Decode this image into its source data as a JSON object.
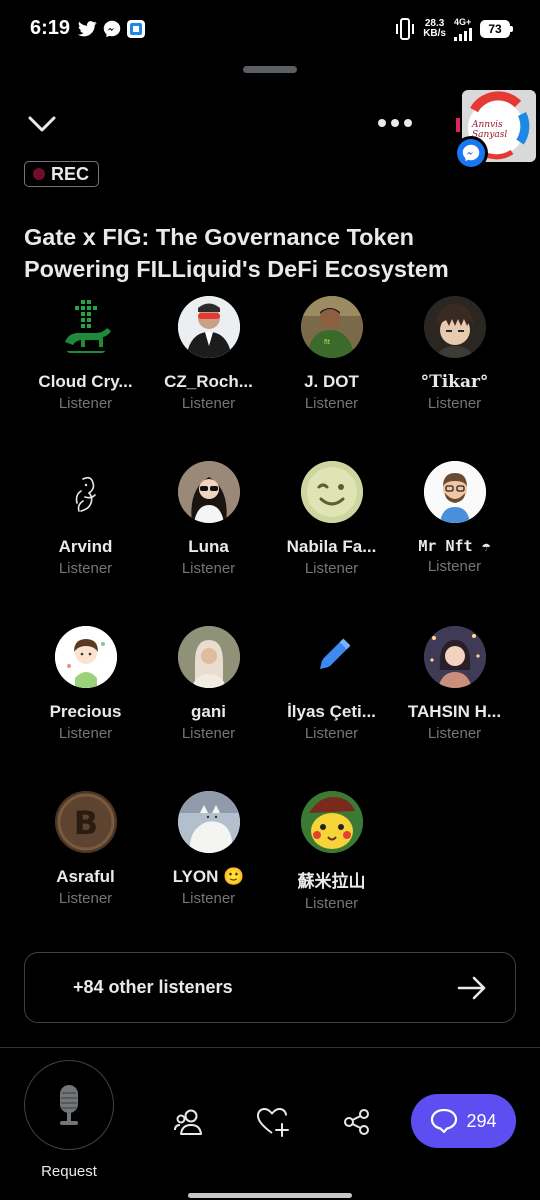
{
  "status_bar": {
    "time": "6:19",
    "net_speed_value": "28.3",
    "net_speed_unit": "KB/s",
    "network_type": "4G+",
    "battery": "73",
    "notification_icons": [
      "twitter-icon",
      "messenger-icon",
      "app-icon"
    ]
  },
  "header": {
    "rec_label": "REC",
    "title": "Gate x FIG: The Governance Token Powering FILLiquid's DeFi Ecosystem",
    "chat_head_text": "Annvis Sanyasl"
  },
  "participants": [
    {
      "name": "Cloud Cry...",
      "role": "Listener",
      "avatar": "green-bull-icon"
    },
    {
      "name": "CZ_Roch...",
      "role": "Listener",
      "avatar": "photo-man-suit"
    },
    {
      "name": "J. DOT",
      "role": "Listener",
      "avatar": "photo-man-green"
    },
    {
      "name": "°Tikar°",
      "role": "Listener",
      "avatar": "anime-boy"
    },
    {
      "name": "Arvind",
      "role": "Listener",
      "avatar": "line-art-hand"
    },
    {
      "name": "Luna",
      "role": "Listener",
      "avatar": "photo-woman-sunglasses"
    },
    {
      "name": "Nabila Fa...",
      "role": "Listener",
      "avatar": "wink-face"
    },
    {
      "name": "Mr Nft ☂",
      "role": "Listener",
      "avatar": "cartoon-man-glasses"
    },
    {
      "name": "Precious",
      "role": "Listener",
      "avatar": "cartoon-girl"
    },
    {
      "name": "gani",
      "role": "Listener",
      "avatar": "photo-woman-hijab"
    },
    {
      "name": "İlyas Çeti...",
      "role": "Listener",
      "avatar": "blue-pen-icon"
    },
    {
      "name": "TAHSIN H...",
      "role": "Listener",
      "avatar": "anime-girl-lights"
    },
    {
      "name": "Asraful",
      "role": "Listener",
      "avatar": "bitcoin-coin"
    },
    {
      "name": "LYON 🙂",
      "role": "Listener",
      "avatar": "white-cat"
    },
    {
      "name": "蘇米拉山",
      "role": "Listener",
      "avatar": "pikachu"
    }
  ],
  "others": {
    "label": "+84 other listeners"
  },
  "bottom_bar": {
    "request_label": "Request",
    "chat_count": "294"
  },
  "colors": {
    "background": "#000000",
    "accent": "#5c4ef0",
    "secondary_text": "#71767b",
    "rec_dot": "#6e0e2a"
  }
}
